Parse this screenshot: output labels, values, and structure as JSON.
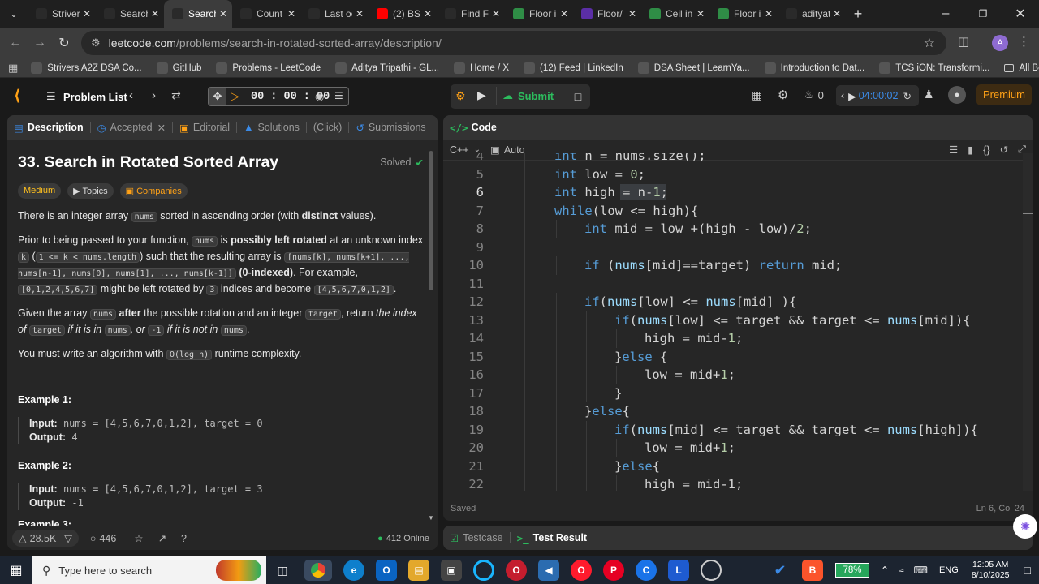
{
  "browser": {
    "tabs": [
      {
        "title": "Striver",
        "icon": "tuf-icon",
        "color": "#2a2a2a",
        "active": false
      },
      {
        "title": "Search",
        "icon": "leetcode-icon",
        "color": "#2a2a2a",
        "active": false
      },
      {
        "title": "Search",
        "icon": "leetcode-icon",
        "color": "#2a2a2a",
        "active": true
      },
      {
        "title": "Count",
        "icon": "tuf-icon",
        "color": "#2a2a2a",
        "active": false
      },
      {
        "title": "Last oc",
        "icon": "tuf-icon",
        "color": "#2a2a2a",
        "active": false
      },
      {
        "title": "(2) BS",
        "icon": "youtube-icon",
        "color": "#ff0000",
        "active": false
      },
      {
        "title": "Find Fi",
        "icon": "leetcode-icon",
        "color": "#2a2a2a",
        "active": false
      },
      {
        "title": "Floor i",
        "icon": "gfg-icon",
        "color": "#2f8d46",
        "active": false
      },
      {
        "title": "Floor/",
        "icon": "w-icon",
        "color": "#5b2ea6",
        "active": false
      },
      {
        "title": "Ceil in",
        "icon": "gfg-icon",
        "color": "#2f8d46",
        "active": false
      },
      {
        "title": "Floor i",
        "icon": "gfg-icon",
        "color": "#2f8d46",
        "active": false
      },
      {
        "title": "adityat",
        "icon": "leetcode-icon",
        "color": "#2a2a2a",
        "active": false
      }
    ],
    "url_host": "leetcode.com",
    "url_path": "/problems/search-in-rotated-sorted-array/description/",
    "profile_letter": "A",
    "bookmarks": [
      {
        "label": "Strivers A2Z DSA Co...",
        "icon": "tuf-icon"
      },
      {
        "label": "GitHub",
        "icon": "github-icon"
      },
      {
        "label": "Problems - LeetCode",
        "icon": "leetcode-icon"
      },
      {
        "label": "Aditya Tripathi - GL...",
        "icon": "gfg-icon"
      },
      {
        "label": "Home / X",
        "icon": "x-icon"
      },
      {
        "label": "(12) Feed | LinkedIn",
        "icon": "linkedin-icon"
      },
      {
        "label": "DSA Sheet | LearnYa...",
        "icon": "learnyard-icon"
      },
      {
        "label": "Introduction to Dat...",
        "icon": "c-icon"
      },
      {
        "label": "TCS iON: Transformi...",
        "icon": "tcs-icon"
      }
    ],
    "all_bookmarks": "All Bookmarks"
  },
  "header": {
    "problem_list": "Problem List",
    "timer": "00 : 00 : 00",
    "submit": "Submit",
    "streak": "0",
    "session_time": "04:00:02",
    "premium": "Premium"
  },
  "left": {
    "tabs": [
      "Description",
      "Accepted",
      "Editorial",
      "Solutions",
      "(Click)",
      "Submissions"
    ],
    "title": "33. Search in Rotated Sorted Array",
    "status": "Solved",
    "difficulty": "Medium",
    "topics": "Topics",
    "companies": "Companies",
    "p1": {
      "a": "There is an integer array ",
      "code1": "nums",
      "b": " sorted in ascending order (with ",
      "bold": "distinct",
      "c": " values)."
    },
    "p2": {
      "a": "Prior to being passed to your function, ",
      "code1": "nums",
      "b": " is ",
      "bold1": "possibly left rotated",
      "c": " at an unknown index ",
      "code2": "k",
      "code3": "1 <= k < nums.length",
      "d": " such that the resulting array is ",
      "code4": "[nums[k], nums[k+1], ..., nums[n-1], nums[0], nums[1], ..., nums[k-1]]",
      "bold2": "(0-indexed)",
      "e": ". For example, ",
      "code5": "[0,1,2,4,5,6,7]",
      "f": " might be left rotated by ",
      "code6": "3",
      "g": " indices and become ",
      "code7": "[4,5,6,7,0,1,2]",
      "h": "."
    },
    "p3": {
      "a": "Given the array ",
      "code1": "nums",
      "bold": "after",
      "b": " the possible rotation and an integer ",
      "code2": "target",
      "c": ", return ",
      "it1": "the index of",
      "code3": "target",
      "it2": " if it is in ",
      "code4": "nums",
      "it3": ", or ",
      "code5": "-1",
      "it4": " if it is not in ",
      "code6": "nums",
      "d": "."
    },
    "p4": {
      "a": "You must write an algorithm with ",
      "code1": "O(log n)",
      "b": " runtime complexity."
    },
    "ex1": {
      "title": "Example 1:",
      "input_label": "Input:",
      "input": " nums = [4,5,6,7,0,1,2], target = 0",
      "output_label": "Output:",
      "output": " 4"
    },
    "ex2": {
      "title": "Example 2:",
      "input_label": "Input:",
      "input": " nums = [4,5,6,7,0,1,2], target = 3",
      "output_label": "Output:",
      "output": " -1"
    },
    "ex3_title": "Example 3:",
    "likes": "28.5K",
    "comments": "446",
    "online": "412 Online"
  },
  "right": {
    "tab": "Code",
    "language": "C++",
    "mode": "Auto",
    "saved": "Saved",
    "cursor": "Ln 6, Col 24",
    "lines": [
      {
        "n": "4",
        "indent": 0,
        "html": [
          [
            "ty",
            "int"
          ],
          [
            "id",
            " n = nums.size();"
          ]
        ]
      },
      {
        "n": "5",
        "indent": 0,
        "html": [
          [
            "ty",
            "int"
          ],
          [
            "id",
            " low = "
          ],
          [
            "nm",
            "0"
          ],
          [
            "id",
            ";"
          ]
        ]
      },
      {
        "n": "6",
        "indent": 0,
        "html": [
          [
            "ty",
            "int"
          ],
          [
            "id",
            " high = n-"
          ],
          [
            "nm",
            "1"
          ],
          [
            "id",
            ";"
          ]
        ]
      },
      {
        "n": "7",
        "indent": 0,
        "html": [
          [
            "kw",
            "while"
          ],
          [
            "id",
            "(low <= high){"
          ]
        ]
      },
      {
        "n": "8",
        "indent": 1,
        "html": [
          [
            "ty",
            "int"
          ],
          [
            "id",
            " mid = low +(high - low)/"
          ],
          [
            "nm",
            "2"
          ],
          [
            "id",
            ";"
          ]
        ]
      },
      {
        "n": "9",
        "indent": 0,
        "html": []
      },
      {
        "n": "10",
        "indent": 1,
        "html": [
          [
            "kw",
            "if"
          ],
          [
            "id",
            " ("
          ],
          [
            "vr",
            "nums"
          ],
          [
            "id",
            "[mid]==target) "
          ],
          [
            "kw",
            "return"
          ],
          [
            "id",
            " mid;"
          ]
        ]
      },
      {
        "n": "11",
        "indent": 0,
        "html": []
      },
      {
        "n": "12",
        "indent": 1,
        "html": [
          [
            "kw",
            "if"
          ],
          [
            "id",
            "("
          ],
          [
            "vr",
            "nums"
          ],
          [
            "id",
            "[low] <= "
          ],
          [
            "vr",
            "nums"
          ],
          [
            "id",
            "[mid] ){"
          ]
        ]
      },
      {
        "n": "13",
        "indent": 2,
        "html": [
          [
            "kw",
            "if"
          ],
          [
            "id",
            "("
          ],
          [
            "vr",
            "nums"
          ],
          [
            "id",
            "[low] <= target && target <= "
          ],
          [
            "vr",
            "nums"
          ],
          [
            "id",
            "[mid]){"
          ]
        ]
      },
      {
        "n": "14",
        "indent": 3,
        "html": [
          [
            "id",
            "high = mid-"
          ],
          [
            "nm",
            "1"
          ],
          [
            "id",
            ";"
          ]
        ]
      },
      {
        "n": "15",
        "indent": 2,
        "html": [
          [
            "id",
            "}"
          ],
          [
            "kw",
            "else"
          ],
          [
            "id",
            " {"
          ]
        ]
      },
      {
        "n": "16",
        "indent": 3,
        "html": [
          [
            "id",
            "low = mid+"
          ],
          [
            "nm",
            "1"
          ],
          [
            "id",
            ";"
          ]
        ]
      },
      {
        "n": "17",
        "indent": 2,
        "html": [
          [
            "id",
            "}"
          ]
        ]
      },
      {
        "n": "18",
        "indent": 1,
        "html": [
          [
            "id",
            "}"
          ],
          [
            "kw",
            "else"
          ],
          [
            "id",
            "{"
          ]
        ]
      },
      {
        "n": "19",
        "indent": 2,
        "html": [
          [
            "kw",
            "if"
          ],
          [
            "id",
            "("
          ],
          [
            "vr",
            "nums"
          ],
          [
            "id",
            "[mid] <= target && target <= "
          ],
          [
            "vr",
            "nums"
          ],
          [
            "id",
            "[high]){"
          ]
        ]
      },
      {
        "n": "20",
        "indent": 3,
        "html": [
          [
            "id",
            "low = mid+"
          ],
          [
            "nm",
            "1"
          ],
          [
            "id",
            ";"
          ]
        ]
      },
      {
        "n": "21",
        "indent": 2,
        "html": [
          [
            "id",
            "}"
          ],
          [
            "kw",
            "else"
          ],
          [
            "id",
            "{"
          ]
        ]
      },
      {
        "n": "22",
        "indent": 3,
        "html": [
          [
            "id",
            "high = mid-1;"
          ]
        ]
      }
    ]
  },
  "bottom": {
    "testcase": "Testcase",
    "test_result": "Test Result"
  },
  "taskbar": {
    "search_placeholder": "Type here to search",
    "battery": "78%",
    "lang": "ENG",
    "time": "12:05 AM",
    "date": "8/10/2025"
  }
}
